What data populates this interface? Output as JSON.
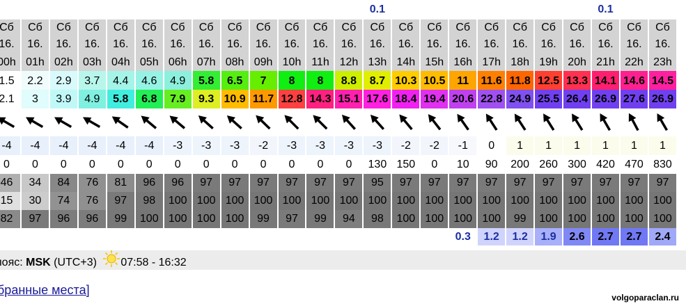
{
  "colors": {
    "header_bg": "#d3d3d3",
    "precip_text": "#1c2fa0",
    "tz_bar_bg": "#ececec",
    "link": "#1a1a9a"
  },
  "precip_top": [
    "",
    "",
    "",
    "",
    "",
    "",
    "",
    "",
    "",
    "",
    "",
    "",
    "",
    "0.1",
    "",
    "",
    "",
    "",
    "",
    "",
    "",
    "0.1",
    "",
    ""
  ],
  "days": [
    "Сб",
    "Сб",
    "Сб",
    "Сб",
    "Сб",
    "Сб",
    "Сб",
    "Сб",
    "Сб",
    "Сб",
    "Сб",
    "Сб",
    "Сб",
    "Сб",
    "Сб",
    "Сб",
    "Сб",
    "Сб",
    "Сб",
    "Сб",
    "Сб",
    "Сб",
    "Сб",
    "Сб"
  ],
  "dates": [
    "16.",
    "16.",
    "16.",
    "16.",
    "16.",
    "16.",
    "16.",
    "16.",
    "16.",
    "16.",
    "16.",
    "16.",
    "16.",
    "16.",
    "16.",
    "16.",
    "16.",
    "16.",
    "16.",
    "16.",
    "16.",
    "16.",
    "16.",
    "16."
  ],
  "hours": [
    "00h",
    "01h",
    "02h",
    "03h",
    "04h",
    "05h",
    "06h",
    "07h",
    "08h",
    "09h",
    "10h",
    "11h",
    "12h",
    "13h",
    "14h",
    "15h",
    "16h",
    "17h",
    "18h",
    "19h",
    "20h",
    "21h",
    "22h",
    "23h"
  ],
  "row_t1": {
    "values": [
      "1.5",
      "2.2",
      "2.9",
      "3.7",
      "4.4",
      "4.6",
      "4.9",
      "5.8",
      "6.5",
      "7",
      "8",
      "8",
      "8.8",
      "8.7",
      "10.3",
      "10.5",
      "11",
      "11.6",
      "11.8",
      "12.5",
      "13.3",
      "14.1",
      "14.6",
      "14.5"
    ],
    "colors": [
      "#ffffff",
      "#f0fcfc",
      "#d8fafa",
      "#b8f6ec",
      "#a4f4e8",
      "#96f2e4",
      "#8cf0dc",
      "#33ee33",
      "#55ee11",
      "#66ee00",
      "#11ee11",
      "#11ee11",
      "#ccee00",
      "#e0ee00",
      "#ffcc00",
      "#ffbb00",
      "#ffa500",
      "#ff7f00",
      "#ff6600",
      "#ff3f2f",
      "#ff3050",
      "#ff1f6f",
      "#ff2090",
      "#ff20a0"
    ]
  },
  "row_t2": {
    "values": [
      "2.1",
      "3",
      "3.9",
      "4.9",
      "5.8",
      "6.8",
      "7.9",
      "9.3",
      "10.9",
      "11.7",
      "12.8",
      "14.3",
      "15.1",
      "17.6",
      "18.4",
      "19.4",
      "20.6",
      "22.8",
      "24.9",
      "25.5",
      "26.4",
      "26.9",
      "27.6",
      "26.9"
    ],
    "colors": [
      "#ffffff",
      "#e0fcfc",
      "#c0f8f8",
      "#80f0e0",
      "#40eee0",
      "#22ee55",
      "#66ee22",
      "#ddee22",
      "#ffbb00",
      "#ff9900",
      "#ff4040",
      "#ff2080",
      "#ff20b0",
      "#ff20e0",
      "#f020f0",
      "#e030f0",
      "#c040f0",
      "#a050f0",
      "#8050f0",
      "#7040f0",
      "#7040f0",
      "#7040f0",
      "#7040f0",
      "#7040f0"
    ]
  },
  "wind_dir_icon": "wind-arrow-icon",
  "wind_dir_angles": [
    -60,
    -60,
    -60,
    -60,
    -55,
    -50,
    -50,
    -48,
    -48,
    -46,
    -45,
    -45,
    -42,
    -42,
    -40,
    -38,
    -35,
    -33,
    -33,
    -32,
    -32,
    -30,
    -28,
    -30
  ],
  "row_temp": {
    "values": [
      "-4",
      "-4",
      "-4",
      "-4",
      "-4",
      "-4",
      "-3",
      "-3",
      "-3",
      "-2",
      "-3",
      "-3",
      "-3",
      "-3",
      "-2",
      "-2",
      "-1",
      "0",
      "1",
      "1",
      "1",
      "1",
      "1",
      "1"
    ],
    "colors": [
      "#e8f0fc",
      "#e8f0fc",
      "#e8f0fc",
      "#e8f0fc",
      "#e8f0fc",
      "#e8f0fc",
      "#eef4fc",
      "#eef4fc",
      "#eef4fc",
      "#f2f6fc",
      "#eef4fc",
      "#eef4fc",
      "#eef4fc",
      "#eef4fc",
      "#f2f6fc",
      "#f2f6fc",
      "#f6f8fc",
      "#ffffff",
      "#fcfcec",
      "#fcfcec",
      "#fcfcec",
      "#fcfcec",
      "#fcfcec",
      "#fcfcec"
    ]
  },
  "row_radiation": [
    "0",
    "0",
    "0",
    "0",
    "0",
    "0",
    "0",
    "0",
    "0",
    "0",
    "0",
    "0",
    "0",
    "130",
    "150",
    "0",
    "10",
    "90",
    "200",
    "260",
    "300",
    "420",
    "470",
    "830"
  ],
  "row_cloud_low": {
    "values": [
      "46",
      "34",
      "84",
      "76",
      "81",
      "96",
      "96",
      "97",
      "97",
      "97",
      "97",
      "97",
      "97",
      "95",
      "97",
      "97",
      "97",
      "97",
      "97",
      "97",
      "97",
      "97",
      "97",
      "97"
    ],
    "colors": [
      "#b0b0b0",
      "#c8c8c8",
      "#888888",
      "#909090",
      "#8c8c8c",
      "#7c7c7c",
      "#7c7c7c",
      "#7a7a7a",
      "#7a7a7a",
      "#7a7a7a",
      "#7a7a7a",
      "#7a7a7a",
      "#7a7a7a",
      "#7c7c7c",
      "#7a7a7a",
      "#7a7a7a",
      "#7a7a7a",
      "#7a7a7a",
      "#7a7a7a",
      "#7a7a7a",
      "#7a7a7a",
      "#7a7a7a",
      "#7a7a7a",
      "#7a7a7a"
    ]
  },
  "row_cloud_mid": {
    "values": [
      "15",
      "30",
      "74",
      "76",
      "97",
      "98",
      "100",
      "100",
      "100",
      "100",
      "100",
      "100",
      "100",
      "100",
      "100",
      "100",
      "100",
      "100",
      "100",
      "100",
      "100",
      "100",
      "100",
      "100"
    ],
    "colors": [
      "#e0e0e0",
      "#cccccc",
      "#929292",
      "#909090",
      "#7a7a7a",
      "#787878",
      "#767676",
      "#767676",
      "#767676",
      "#767676",
      "#767676",
      "#767676",
      "#767676",
      "#767676",
      "#767676",
      "#767676",
      "#767676",
      "#767676",
      "#767676",
      "#767676",
      "#767676",
      "#767676",
      "#767676",
      "#767676"
    ]
  },
  "row_cloud_high": {
    "values": [
      "82",
      "97",
      "96",
      "96",
      "99",
      "100",
      "100",
      "100",
      "100",
      "99",
      "97",
      "99",
      "94",
      "98",
      "100",
      "100",
      "100",
      "100",
      "99",
      "100",
      "100",
      "100",
      "100",
      "100"
    ],
    "colors": [
      "#8a8a8a",
      "#7a7a7a",
      "#7c7c7c",
      "#7c7c7c",
      "#787878",
      "#767676",
      "#767676",
      "#767676",
      "#767676",
      "#787878",
      "#7a7a7a",
      "#787878",
      "#7e7e7e",
      "#787878",
      "#767676",
      "#767676",
      "#767676",
      "#767676",
      "#787878",
      "#767676",
      "#767676",
      "#767676",
      "#767676",
      "#767676"
    ]
  },
  "row_rain": {
    "values": [
      "",
      "",
      "",
      "",
      "",
      "",
      "",
      "",
      "",
      "",
      "",
      "",
      "",
      "",
      "",
      "",
      "0.3",
      "1.2",
      "1.2",
      "1.9",
      "2.6",
      "2.7",
      "2.7",
      "2.4"
    ],
    "colors": [
      "#ffffff",
      "#ffffff",
      "#ffffff",
      "#ffffff",
      "#ffffff",
      "#ffffff",
      "#ffffff",
      "#ffffff",
      "#ffffff",
      "#ffffff",
      "#ffffff",
      "#ffffff",
      "#ffffff",
      "#ffffff",
      "#ffffff",
      "#ffffff",
      "#ffffff",
      "#d0d4fc",
      "#d0d4fc",
      "#a8b0fa",
      "#8088f6",
      "#7078f4",
      "#7078f4",
      "#a0a8f8"
    ],
    "text_colors": [
      "#000",
      "#000",
      "#000",
      "#000",
      "#000",
      "#000",
      "#000",
      "#000",
      "#000",
      "#000",
      "#000",
      "#000",
      "#000",
      "#000",
      "#000",
      "#000",
      "#1c2fa0",
      "#1c2fa0",
      "#1c2fa0",
      "#1c2fa0",
      "#000000",
      "#000000",
      "#000000",
      "#000000"
    ],
    "bold_last": false
  },
  "tz": {
    "label": "пояс:",
    "code": "MSK",
    "offset": "(UTC+3)",
    "sun_icon": "sun-icon",
    "sun_times": "07:58 - 16:32"
  },
  "favorites": {
    "text": "бранные места]"
  },
  "watermark": "volgoparaclan.ru"
}
